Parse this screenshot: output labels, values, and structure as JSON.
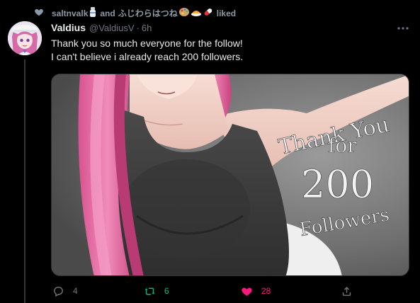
{
  "context": {
    "user1": "saltnvalk",
    "conjunction": "and",
    "user2": "ふじわらはつね",
    "action": "liked"
  },
  "tweet": {
    "display_name": "Valdius",
    "handle": "@ValdiusV",
    "separator": "·",
    "time": "6h",
    "text_line1": "Thank you so much everyone for the follow!",
    "text_line2": "I can't believe i already reach 200 followers."
  },
  "media": {
    "overlay_line1": "Thank You",
    "overlay_line2": "for",
    "overlay_line3": "200",
    "overlay_line4": "Followers"
  },
  "actions": {
    "reply_count": "4",
    "retweet_count": "6",
    "like_count": "28"
  },
  "colors": {
    "background": "#000000",
    "muted": "#71767b",
    "retweet": "#00ba7c",
    "like": "#f91880",
    "text": "#e7e9ea"
  },
  "icons": [
    "heart-icon",
    "more-icon",
    "reply-icon",
    "retweet-icon",
    "like-icon",
    "share-icon"
  ]
}
